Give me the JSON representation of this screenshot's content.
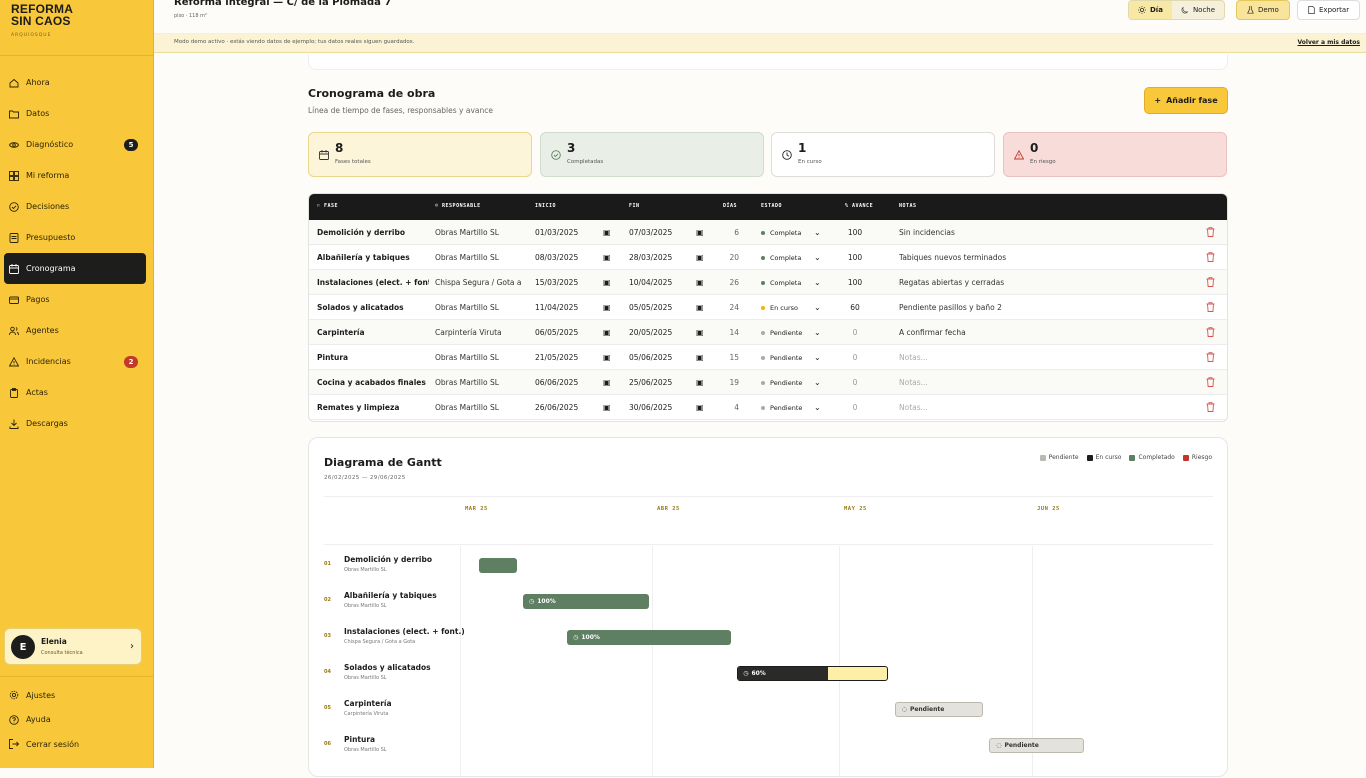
{
  "brand": {
    "line1": "REFORMA",
    "line2": "SIN CAOS",
    "sub": "ARQUIOSQUE"
  },
  "nav": [
    {
      "label": "Ahora",
      "icon": "home-icon"
    },
    {
      "label": "Datos",
      "icon": "folder-icon"
    },
    {
      "label": "Diagnóstico",
      "icon": "eye-icon",
      "badge": "5"
    },
    {
      "label": "Mi reforma",
      "icon": "grid-icon"
    },
    {
      "label": "Decisiones",
      "icon": "check-circle-icon"
    },
    {
      "label": "Presupuesto",
      "icon": "receipt-icon"
    },
    {
      "label": "Cronograma",
      "icon": "calendar-icon",
      "active": true
    },
    {
      "label": "Pagos",
      "icon": "card-icon"
    },
    {
      "label": "Agentes",
      "icon": "users-icon"
    },
    {
      "label": "Incidencias",
      "icon": "warning-icon",
      "badge": "2"
    },
    {
      "label": "Actas",
      "icon": "clipboard-icon"
    },
    {
      "label": "Descargas",
      "icon": "download-icon"
    }
  ],
  "user": {
    "initial": "E",
    "name": "Elenia",
    "role": "Consulta técnica"
  },
  "bottom_nav": [
    {
      "label": "Ajustes",
      "icon": "gear-icon"
    },
    {
      "label": "Ayuda",
      "icon": "help-icon"
    },
    {
      "label": "Cerrar sesión",
      "icon": "logout-icon"
    }
  ],
  "header": {
    "title": "Reforma integral — C/ de la Plomada 7",
    "subtitle": "piso · 118 m²",
    "day": "Día",
    "night": "Noche",
    "demo": "Demo",
    "export": "Exportar"
  },
  "banner": {
    "text": "Modo demo activo · estás viendo datos de ejemplo; tus datos reales siguen guardados.",
    "back": "Volver a mis datos"
  },
  "section": {
    "title": "Cronograma de obra",
    "subtitle": "Línea de tiempo de fases, responsables y avance",
    "add_button": "Añadir fase"
  },
  "stats": [
    {
      "value": "8",
      "label": "Fases totales"
    },
    {
      "value": "3",
      "label": "Completadas"
    },
    {
      "value": "1",
      "label": "En curso"
    },
    {
      "value": "0",
      "label": "En riesgo"
    }
  ],
  "table": {
    "headers": [
      "FASE",
      "RESPONSABLE",
      "INICIO",
      "FIN",
      "DÍAS",
      "ESTADO",
      "% AVANCE",
      "NOTAS"
    ],
    "rows": [
      {
        "fase": "Demolición y derribo",
        "resp": "Obras Martillo SL",
        "ini": "01/03/2025",
        "fin": "07/03/2025",
        "dias": "6",
        "estado": "Completa",
        "avance": "100",
        "notas": "Sin incidencias"
      },
      {
        "fase": "Albañilería y tabiques",
        "resp": "Obras Martillo SL",
        "ini": "08/03/2025",
        "fin": "28/03/2025",
        "dias": "20",
        "estado": "Completa",
        "avance": "100",
        "notas": "Tabiques nuevos terminados"
      },
      {
        "fase": "Instalaciones (elect. + fontanería)",
        "resp": "Chispa Segura / Gota a Gota",
        "ini": "15/03/2025",
        "fin": "10/04/2025",
        "dias": "26",
        "estado": "Completa",
        "avance": "100",
        "notas": "Regatas abiertas y cerradas"
      },
      {
        "fase": "Solados y alicatados",
        "resp": "Obras Martillo SL",
        "ini": "11/04/2025",
        "fin": "05/05/2025",
        "dias": "24",
        "estado": "En curso",
        "avance": "60",
        "notas": "Pendiente pasillos y baño 2"
      },
      {
        "fase": "Carpintería",
        "resp": "Carpintería Viruta",
        "ini": "06/05/2025",
        "fin": "20/05/2025",
        "dias": "14",
        "estado": "Pendiente",
        "avance": "0",
        "notas": "A confirmar fecha"
      },
      {
        "fase": "Pintura",
        "resp": "Obras Martillo SL",
        "ini": "21/05/2025",
        "fin": "05/06/2025",
        "dias": "15",
        "estado": "Pendiente",
        "avance": "0",
        "notas": "Notas..."
      },
      {
        "fase": "Cocina y acabados finales",
        "resp": "Obras Martillo SL",
        "ini": "06/06/2025",
        "fin": "25/06/2025",
        "dias": "19",
        "estado": "Pendiente",
        "avance": "0",
        "notas": "Notas..."
      },
      {
        "fase": "Remates y limpieza",
        "resp": "Obras Martillo SL",
        "ini": "26/06/2025",
        "fin": "30/06/2025",
        "dias": "4",
        "estado": "Pendiente",
        "avance": "0",
        "notas": "Notas..."
      }
    ]
  },
  "gantt": {
    "title": "Diagrama de Gantt",
    "range": "26/02/2025 — 29/06/2025",
    "legend": [
      "Pendiente",
      "En curso",
      "Completado",
      "Riesgo"
    ],
    "months": [
      "MAR 25",
      "ABR 25",
      "MAY 25",
      "JUN 25"
    ],
    "rows": [
      {
        "num": "01",
        "name": "Demolición y derribo",
        "resp": "Obras Martillo SL",
        "kind": "done",
        "label": ""
      },
      {
        "num": "02",
        "name": "Albañilería y tabiques",
        "resp": "Obras Martillo SL",
        "kind": "done",
        "label": "100%"
      },
      {
        "num": "03",
        "name": "Instalaciones (elect. + font.)",
        "resp": "Chispa Segura / Gota a Gota",
        "kind": "done",
        "label": "100%"
      },
      {
        "num": "04",
        "name": "Solados y alicatados",
        "resp": "Obras Martillo SL",
        "kind": "cur",
        "label": "60%",
        "progress": 0.6
      },
      {
        "num": "05",
        "name": "Carpintería",
        "resp": "Carpintería Viruta",
        "kind": "pend",
        "label": "Pendiente"
      },
      {
        "num": "06",
        "name": "Pintura",
        "resp": "Obras Martillo SL",
        "kind": "pend",
        "label": "Pendiente"
      }
    ]
  },
  "colors": {
    "accent": "#f9c83a",
    "done": "#5e7f62",
    "current": "#2a2a28",
    "pending": "#e4e2dc",
    "risk": "#c0392b"
  }
}
